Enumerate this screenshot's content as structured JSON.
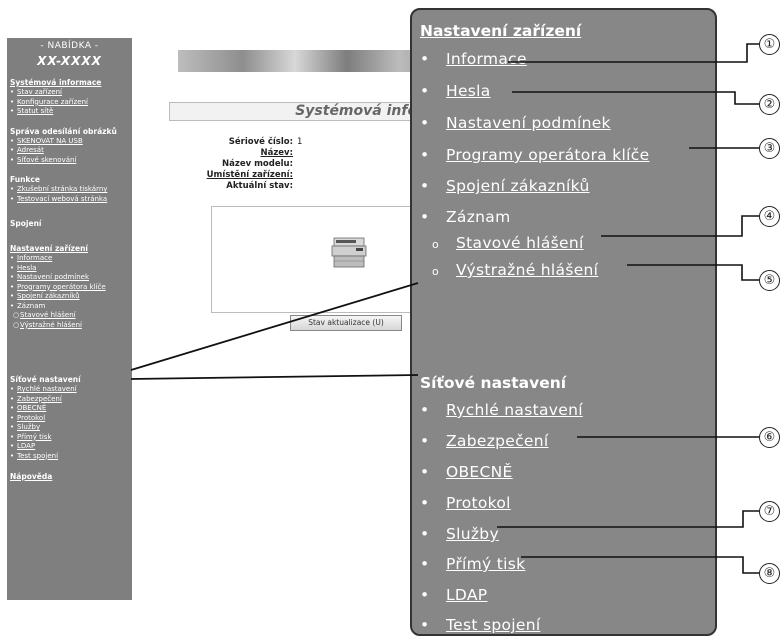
{
  "sidebar": {
    "menu_header": "- NABÍDKA -",
    "model": "XX-XXXX",
    "sections": [
      {
        "title": "Systémová informace",
        "underline": true,
        "items": [
          {
            "label": "Stav zařízení",
            "link": true
          },
          {
            "label": "Konfigurace zařízení",
            "link": true
          },
          {
            "label": "Statut sítě",
            "link": true
          }
        ]
      },
      {
        "title": "Správa odesílání obrázků",
        "underline": false,
        "items": [
          {
            "label": "SKENOVAT NA USB",
            "link": true
          },
          {
            "label": "Adresát",
            "link": true
          },
          {
            "label": "Síťové skenování",
            "link": true
          }
        ]
      },
      {
        "title": "Funkce",
        "underline": false,
        "items": [
          {
            "label": "Zkušební stránka tiskárny",
            "link": true
          },
          {
            "label": "Testovací webová stránka",
            "link": true
          }
        ]
      },
      {
        "title": "Spojení",
        "underline": false,
        "items": []
      },
      {
        "title": "Nastavení zařízení",
        "underline": true,
        "items": [
          {
            "label": "Informace",
            "link": true
          },
          {
            "label": "Hesla",
            "link": true
          },
          {
            "label": "Nastavení podmínek",
            "link": true
          },
          {
            "label": "Programy operátora klíče",
            "link": true
          },
          {
            "label": "Spojení zákazníků",
            "link": true
          },
          {
            "label": "Záznam",
            "link": false
          },
          {
            "label": "Stavové hlášení",
            "link": true,
            "sub": true
          },
          {
            "label": "Výstražné hlášení",
            "link": true,
            "sub": true
          }
        ]
      },
      {
        "title": "Síťové nastavení",
        "underline": false,
        "items": [
          {
            "label": "Rychlé nastavení",
            "link": true
          },
          {
            "label": "Zabezpečení",
            "link": true
          },
          {
            "label": "OBECNĚ",
            "link": true
          },
          {
            "label": "Protokol",
            "link": true
          },
          {
            "label": "Služby",
            "link": true
          },
          {
            "label": "Přímý tisk",
            "link": true
          },
          {
            "label": "LDAP",
            "link": true
          },
          {
            "label": "Test spojení",
            "link": true
          }
        ]
      },
      {
        "title": "Nápověda",
        "underline": true,
        "items": []
      }
    ]
  },
  "main": {
    "heading": "Systémová informa",
    "rows": [
      {
        "label": "Sériové číslo:",
        "value": "1",
        "link": false
      },
      {
        "label": "Název:",
        "value": "",
        "link": true
      },
      {
        "label": "Název modelu:",
        "value": "",
        "link": false
      },
      {
        "label": "Umístění zařízení:",
        "value": "",
        "link": true
      },
      {
        "label": "Aktuální stav:",
        "value": "",
        "link": false
      }
    ],
    "refresh_button": "Stav aktualizace (U)"
  },
  "zoom": {
    "section1_title": "Nastavení zařízení",
    "section1_items": [
      {
        "label": "Informace",
        "callout": "①"
      },
      {
        "label": "Hesla",
        "callout": "②"
      },
      {
        "label": "Nastavení podmínek",
        "callout": ""
      },
      {
        "label": "Programy operátora klíče",
        "callout": "③"
      },
      {
        "label": "Spojení zákazníků",
        "callout": ""
      },
      {
        "label": "Záznam",
        "callout": "",
        "static": true
      },
      {
        "label": "Stavové hlášení",
        "callout": "④",
        "sub": true
      },
      {
        "label": "Výstražné hlášení",
        "callout": "⑤",
        "sub": true
      }
    ],
    "section2_title": "Síťové nastavení",
    "section2_items": [
      {
        "label": "Rychlé nastavení",
        "callout": ""
      },
      {
        "label": "Zabezpečení",
        "callout": "⑥"
      },
      {
        "label": "OBECNĚ",
        "callout": ""
      },
      {
        "label": "Protokol",
        "callout": ""
      },
      {
        "label": "Služby",
        "callout": "⑦"
      },
      {
        "label": "Přímý tisk",
        "callout": "⑧"
      },
      {
        "label": "LDAP",
        "callout": ""
      },
      {
        "label": "Test spojení",
        "callout": ""
      }
    ],
    "bullet": "•",
    "sub_bullet": "o"
  },
  "colors": {
    "sidebar_bg": "#7f7f7f",
    "zoom_bg": "#878787",
    "text": "#ffffff"
  }
}
